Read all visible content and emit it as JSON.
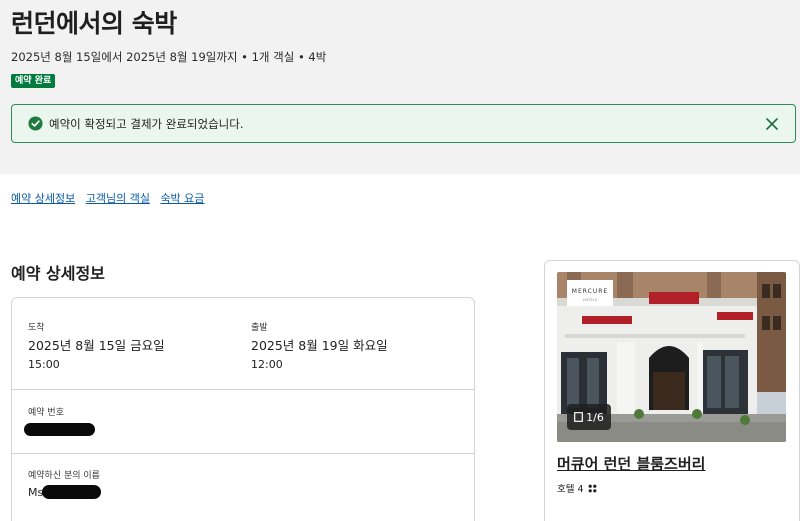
{
  "header": {
    "title": "런던에서의 숙박",
    "subline": "2025년 8월 15일에서 2025년 8월 19일까지 • 1개 객실 • 4박",
    "status_badge": "예약 완료"
  },
  "alert": {
    "message": "예약이 확정되고 결제가 완료되었습니다.",
    "icon": "check-circle-icon",
    "close_icon": "close-icon",
    "color": "#2e8b57"
  },
  "anchors": {
    "details": "예약 상세정보",
    "rooms": "고객님의 객실",
    "price": "숙박 요금"
  },
  "details": {
    "section_title": "예약 상세정보",
    "checkin_label": "도착",
    "checkin_date": "2025년 8월 15일 금요일",
    "checkin_time": "15:00",
    "checkout_label": "출발",
    "checkout_date": "2025년 8월 19일 화요일",
    "checkout_time": "12:00",
    "booking_number_label": "예약 번호",
    "guest_name_label": "예약하신 분의 이름",
    "guest_name_prefix": "Ms"
  },
  "hotel": {
    "logo_text": "MERCURE",
    "logo_sub": "HOTELS",
    "photo_counter": "1/6",
    "name": "머큐어 런던 블룸즈버리",
    "type": "호텔 4",
    "rating_icon": "rating-dots-icon"
  },
  "colors": {
    "accent_green": "#007a3d",
    "link_blue": "#0a5aa8",
    "header_bg": "#f2f2f2"
  }
}
